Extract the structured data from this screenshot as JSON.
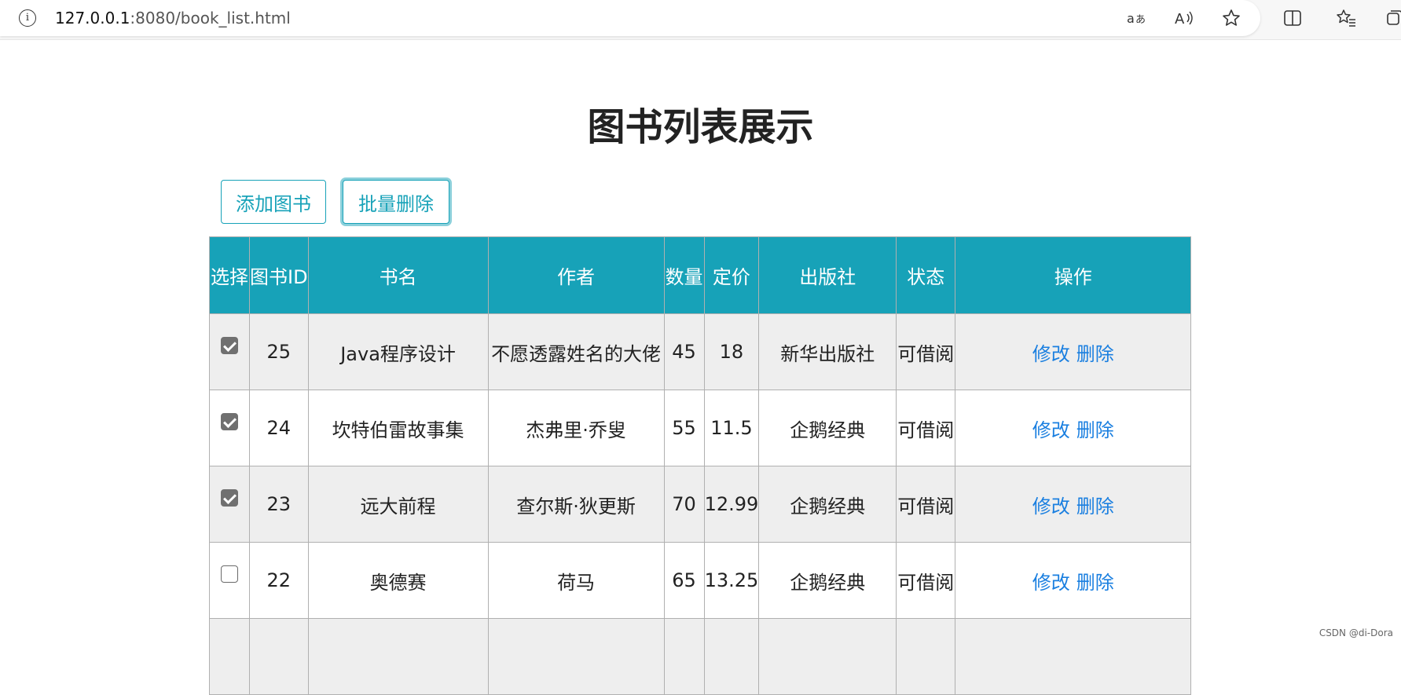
{
  "browser": {
    "url_host": "127.0.0.1",
    "url_rest": ":8080/book_list.html",
    "icons": [
      "info-icon",
      "translate-icon",
      "read-aloud-icon",
      "favorite-star-icon",
      "split-screen-icon",
      "favorites-list-icon",
      "collections-icon"
    ]
  },
  "page": {
    "title": "图书列表展示",
    "add_button": "添加图书",
    "batch_delete_button": "批量删除"
  },
  "table": {
    "headers": [
      "选择",
      "图书ID",
      "书名",
      "作者",
      "数量",
      "定价",
      "出版社",
      "状态",
      "操作"
    ],
    "rows": [
      {
        "checked": true,
        "id": "25",
        "name": "Java程序设计",
        "author": "不愿透露姓名的大佬",
        "qty": "45",
        "price": "18",
        "publisher": "新华出版社",
        "status": "可借阅",
        "edit": "修改",
        "delete": "删除"
      },
      {
        "checked": true,
        "id": "24",
        "name": "坎特伯雷故事集",
        "author": "杰弗里·乔叟",
        "qty": "55",
        "price": "11.5",
        "publisher": "企鹅经典",
        "status": "可借阅",
        "edit": "修改",
        "delete": "删除"
      },
      {
        "checked": true,
        "id": "23",
        "name": "远大前程",
        "author": "查尔斯·狄更斯",
        "qty": "70",
        "price": "12.99",
        "publisher": "企鹅经典",
        "status": "可借阅",
        "edit": "修改",
        "delete": "删除"
      },
      {
        "checked": false,
        "id": "22",
        "name": "奥德赛",
        "author": "荷马",
        "qty": "65",
        "price": "13.25",
        "publisher": "企鹅经典",
        "status": "可借阅",
        "edit": "修改",
        "delete": "删除"
      },
      {
        "checked": false,
        "id": "",
        "name": "",
        "author": "",
        "qty": "",
        "price": "",
        "publisher": "",
        "status": "",
        "edit": "",
        "delete": ""
      }
    ]
  },
  "watermark": "CSDN @di-Dora",
  "colors": {
    "header_bg": "#17a2b8",
    "link": "#1a7fe0",
    "row_shaded": "#eeeeee"
  }
}
